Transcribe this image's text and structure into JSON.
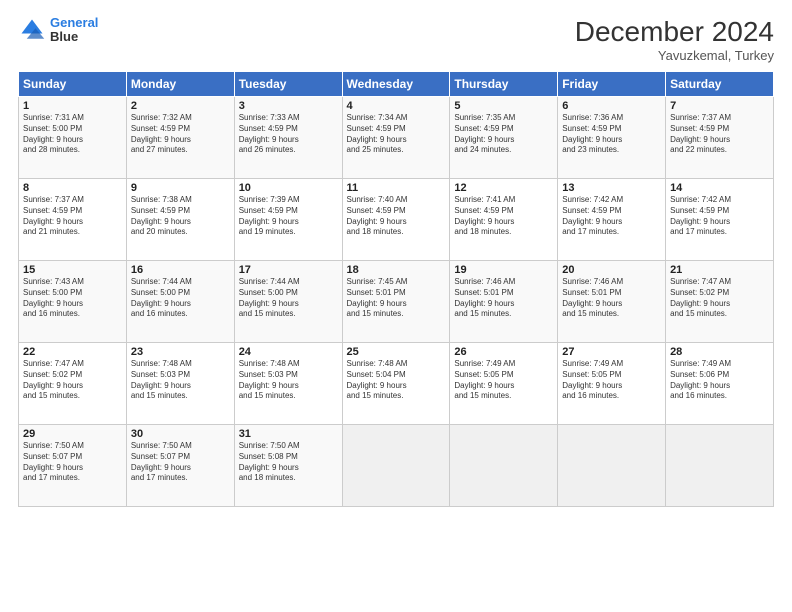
{
  "header": {
    "logo_line1": "General",
    "logo_line2": "Blue",
    "month": "December 2024",
    "location": "Yavuzkemal, Turkey"
  },
  "weekdays": [
    "Sunday",
    "Monday",
    "Tuesday",
    "Wednesday",
    "Thursday",
    "Friday",
    "Saturday"
  ],
  "weeks": [
    [
      {
        "day": "1",
        "info": "Sunrise: 7:31 AM\nSunset: 5:00 PM\nDaylight: 9 hours\nand 28 minutes."
      },
      {
        "day": "2",
        "info": "Sunrise: 7:32 AM\nSunset: 4:59 PM\nDaylight: 9 hours\nand 27 minutes."
      },
      {
        "day": "3",
        "info": "Sunrise: 7:33 AM\nSunset: 4:59 PM\nDaylight: 9 hours\nand 26 minutes."
      },
      {
        "day": "4",
        "info": "Sunrise: 7:34 AM\nSunset: 4:59 PM\nDaylight: 9 hours\nand 25 minutes."
      },
      {
        "day": "5",
        "info": "Sunrise: 7:35 AM\nSunset: 4:59 PM\nDaylight: 9 hours\nand 24 minutes."
      },
      {
        "day": "6",
        "info": "Sunrise: 7:36 AM\nSunset: 4:59 PM\nDaylight: 9 hours\nand 23 minutes."
      },
      {
        "day": "7",
        "info": "Sunrise: 7:37 AM\nSunset: 4:59 PM\nDaylight: 9 hours\nand 22 minutes."
      }
    ],
    [
      {
        "day": "8",
        "info": "Sunrise: 7:37 AM\nSunset: 4:59 PM\nDaylight: 9 hours\nand 21 minutes."
      },
      {
        "day": "9",
        "info": "Sunrise: 7:38 AM\nSunset: 4:59 PM\nDaylight: 9 hours\nand 20 minutes."
      },
      {
        "day": "10",
        "info": "Sunrise: 7:39 AM\nSunset: 4:59 PM\nDaylight: 9 hours\nand 19 minutes."
      },
      {
        "day": "11",
        "info": "Sunrise: 7:40 AM\nSunset: 4:59 PM\nDaylight: 9 hours\nand 18 minutes."
      },
      {
        "day": "12",
        "info": "Sunrise: 7:41 AM\nSunset: 4:59 PM\nDaylight: 9 hours\nand 18 minutes."
      },
      {
        "day": "13",
        "info": "Sunrise: 7:42 AM\nSunset: 4:59 PM\nDaylight: 9 hours\nand 17 minutes."
      },
      {
        "day": "14",
        "info": "Sunrise: 7:42 AM\nSunset: 4:59 PM\nDaylight: 9 hours\nand 17 minutes."
      }
    ],
    [
      {
        "day": "15",
        "info": "Sunrise: 7:43 AM\nSunset: 5:00 PM\nDaylight: 9 hours\nand 16 minutes."
      },
      {
        "day": "16",
        "info": "Sunrise: 7:44 AM\nSunset: 5:00 PM\nDaylight: 9 hours\nand 16 minutes."
      },
      {
        "day": "17",
        "info": "Sunrise: 7:44 AM\nSunset: 5:00 PM\nDaylight: 9 hours\nand 15 minutes."
      },
      {
        "day": "18",
        "info": "Sunrise: 7:45 AM\nSunset: 5:01 PM\nDaylight: 9 hours\nand 15 minutes."
      },
      {
        "day": "19",
        "info": "Sunrise: 7:46 AM\nSunset: 5:01 PM\nDaylight: 9 hours\nand 15 minutes."
      },
      {
        "day": "20",
        "info": "Sunrise: 7:46 AM\nSunset: 5:01 PM\nDaylight: 9 hours\nand 15 minutes."
      },
      {
        "day": "21",
        "info": "Sunrise: 7:47 AM\nSunset: 5:02 PM\nDaylight: 9 hours\nand 15 minutes."
      }
    ],
    [
      {
        "day": "22",
        "info": "Sunrise: 7:47 AM\nSunset: 5:02 PM\nDaylight: 9 hours\nand 15 minutes."
      },
      {
        "day": "23",
        "info": "Sunrise: 7:48 AM\nSunset: 5:03 PM\nDaylight: 9 hours\nand 15 minutes."
      },
      {
        "day": "24",
        "info": "Sunrise: 7:48 AM\nSunset: 5:03 PM\nDaylight: 9 hours\nand 15 minutes."
      },
      {
        "day": "25",
        "info": "Sunrise: 7:48 AM\nSunset: 5:04 PM\nDaylight: 9 hours\nand 15 minutes."
      },
      {
        "day": "26",
        "info": "Sunrise: 7:49 AM\nSunset: 5:05 PM\nDaylight: 9 hours\nand 15 minutes."
      },
      {
        "day": "27",
        "info": "Sunrise: 7:49 AM\nSunset: 5:05 PM\nDaylight: 9 hours\nand 16 minutes."
      },
      {
        "day": "28",
        "info": "Sunrise: 7:49 AM\nSunset: 5:06 PM\nDaylight: 9 hours\nand 16 minutes."
      }
    ],
    [
      {
        "day": "29",
        "info": "Sunrise: 7:50 AM\nSunset: 5:07 PM\nDaylight: 9 hours\nand 17 minutes."
      },
      {
        "day": "30",
        "info": "Sunrise: 7:50 AM\nSunset: 5:07 PM\nDaylight: 9 hours\nand 17 minutes."
      },
      {
        "day": "31",
        "info": "Sunrise: 7:50 AM\nSunset: 5:08 PM\nDaylight: 9 hours\nand 18 minutes."
      },
      null,
      null,
      null,
      null
    ]
  ]
}
